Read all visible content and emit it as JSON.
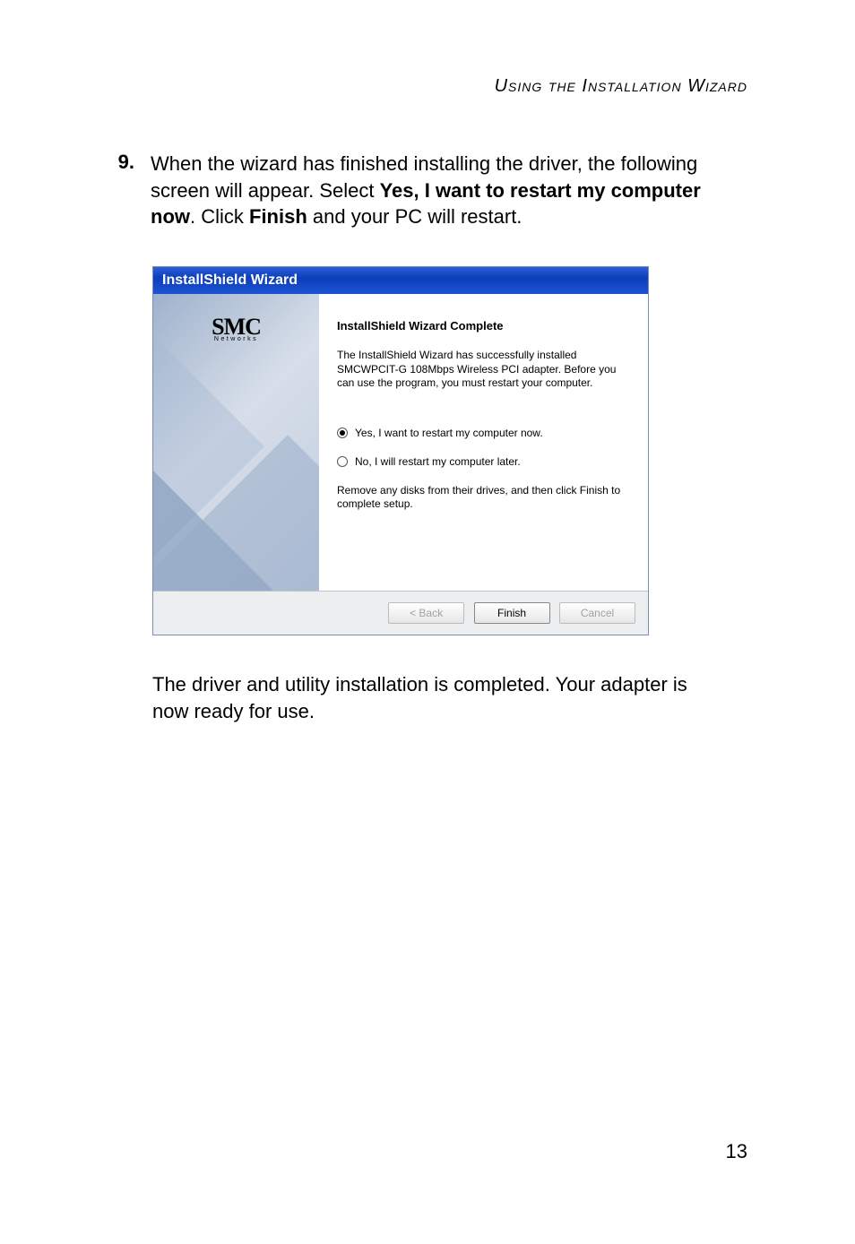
{
  "header": "Using the Installation Wizard",
  "step": {
    "number": "9.",
    "text_part1": "When the wizard has finished installing the driver, the following screen will appear. Select ",
    "bold1": "Yes, I want to restart my computer now",
    "text_part2": ". Click ",
    "bold2": "Finish",
    "text_part3": " and your PC will restart."
  },
  "wizard": {
    "titlebar": "InstallShield Wizard",
    "logo_main": "SMC",
    "logo_sub": "Networks",
    "title": "InstallShield Wizard Complete",
    "description": "The InstallShield Wizard has successfully installed SMCWPCIT-G 108Mbps Wireless PCI adapter.  Before you can use the program, you must restart your computer.",
    "radio_yes": "Yes, I want to restart my computer now.",
    "radio_no": "No, I will restart my computer later.",
    "note": "Remove any disks from their drives, and then click Finish to complete setup.",
    "buttons": {
      "back": "< Back",
      "finish": "Finish",
      "cancel": "Cancel"
    }
  },
  "post_text": "The driver and utility installation is completed. Your adapter is now ready for use.",
  "page_number": "13"
}
